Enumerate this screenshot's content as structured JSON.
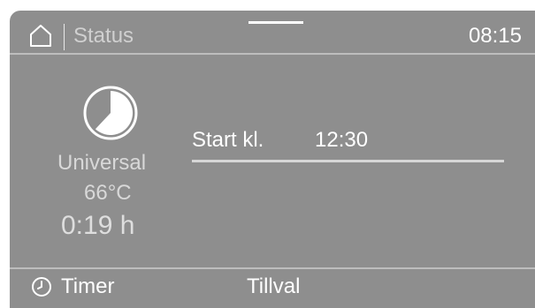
{
  "header": {
    "title": "Status",
    "time": "08:15",
    "home_icon": "home-icon"
  },
  "program": {
    "icon": "pie-progress-icon",
    "name": "Universal",
    "temperature": "66°C",
    "duration": "0:19 h",
    "progress_fraction": 0.62
  },
  "start": {
    "label": "Start kl.",
    "time": "12:30"
  },
  "footer": {
    "timer_icon": "clock-icon",
    "timer_label": "Timer",
    "tillval_label": "Tillval"
  },
  "colors": {
    "background": "#8e8e8e",
    "text_primary": "#ffffff",
    "text_secondary": "#d8d8d8",
    "divider": "#bdbdbd"
  }
}
